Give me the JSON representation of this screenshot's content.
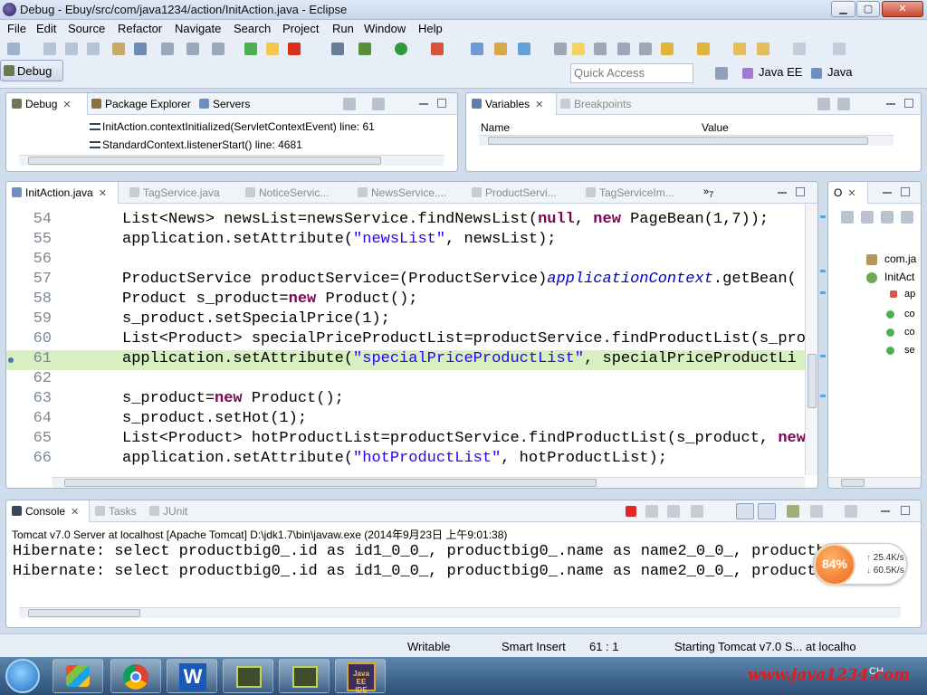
{
  "window": {
    "title": "Debug - Ebuy/src/com/java1234/action/InitAction.java - Eclipse"
  },
  "menu": [
    "File",
    "Edit",
    "Source",
    "Refactor",
    "Navigate",
    "Search",
    "Project",
    "Run",
    "Window",
    "Help"
  ],
  "quick_access": {
    "placeholder": "Quick Access"
  },
  "perspectives": [
    "Java EE",
    "Java",
    "Debug"
  ],
  "debug_view": {
    "tabs": [
      "Debug",
      "Package Explorer",
      "Servers"
    ],
    "frames": [
      "InitAction.contextInitialized(ServletContextEvent) line: 61",
      "StandardContext.listenerStart() line: 4681"
    ]
  },
  "variables_view": {
    "tabs": [
      "Variables",
      "Breakpoints"
    ],
    "columns": [
      "Name",
      "Value"
    ]
  },
  "editor": {
    "tabs": [
      "InitAction.java",
      "TagService.java",
      "NoticeServic...",
      "NewsService....",
      "ProductServi...",
      "TagServiceIm..."
    ],
    "overflow_count": "7",
    "current_line": "61",
    "lines": [
      {
        "n": "54",
        "parts": [
          [
            "",
            "List<News> newsList=newsService.findNewsList("
          ],
          [
            "kw",
            "null"
          ],
          [
            "",
            ", "
          ],
          [
            "kw",
            "new"
          ],
          [
            "",
            " PageBean(1,7));"
          ]
        ]
      },
      {
        "n": "55",
        "parts": [
          [
            "",
            "application.setAttribute("
          ],
          [
            "str",
            "\"newsList\""
          ],
          [
            "",
            ", newsList);"
          ]
        ]
      },
      {
        "n": "56",
        "parts": []
      },
      {
        "n": "57",
        "parts": [
          [
            "",
            "ProductService productService=(ProductService)"
          ],
          [
            "it",
            "applicationContext"
          ],
          [
            "",
            ".getBean("
          ]
        ]
      },
      {
        "n": "58",
        "parts": [
          [
            "",
            "Product s_product="
          ],
          [
            "kw",
            "new"
          ],
          [
            "",
            " Product();"
          ]
        ]
      },
      {
        "n": "59",
        "parts": [
          [
            "",
            "s_product.setSpecialPrice(1);"
          ]
        ]
      },
      {
        "n": "60",
        "parts": [
          [
            "",
            "List<Product> specialPriceProductList=productService.findProductList(s_pro"
          ]
        ]
      },
      {
        "n": "61",
        "parts": [
          [
            "",
            "application.setAttribute("
          ],
          [
            "str",
            "\"specialPriceProductList\""
          ],
          [
            "",
            ", specialPriceProductLi"
          ]
        ]
      },
      {
        "n": "62",
        "parts": []
      },
      {
        "n": "63",
        "parts": [
          [
            "",
            "s_product="
          ],
          [
            "kw",
            "new"
          ],
          [
            "",
            " Product();"
          ]
        ]
      },
      {
        "n": "64",
        "parts": [
          [
            "",
            "s_product.setHot(1);"
          ]
        ]
      },
      {
        "n": "65",
        "parts": [
          [
            "",
            "List<Product> hotProductList=productService.findProductList(s_product, "
          ],
          [
            "kw",
            "new"
          ]
        ]
      },
      {
        "n": "66",
        "parts": [
          [
            "",
            "application.setAttribute("
          ],
          [
            "str",
            "\"hotProductList\""
          ],
          [
            "",
            ", hotProductList);"
          ]
        ]
      }
    ]
  },
  "outline_view": {
    "tab": "O",
    "items": [
      "com.ja",
      "InitAct",
      "ap",
      "co",
      "co",
      "se"
    ]
  },
  "console_view": {
    "tabs": [
      "Console",
      "Tasks",
      "JUnit"
    ],
    "server_line": "Tomcat v7.0 Server at localhost [Apache Tomcat] D:\\jdk1.7\\bin\\javaw.exe (2014年9月23日 上午9:01:38)",
    "lines": [
      "Hibernate: select productbig0_.id as id1_0_0_, productbig0_.name as name2_0_0_, productbi",
      "Hibernate: select productbig0_.id as id1_0_0_, productbig0_.name as name2_0_0_, productbi"
    ]
  },
  "status_bar": {
    "writable": "Writable",
    "insert_mode": "Smart Insert",
    "position": "61 : 1",
    "progress": "Starting Tomcat v7.0 S... at localho"
  },
  "net_widget": {
    "cpu_percent": "84%",
    "up": "25.4K/s",
    "down": "60.5K/s"
  },
  "taskbar": {
    "watermark": "www.java1234.com",
    "ime": "CH"
  },
  "colors": {
    "highlight_line": "#d7efc1",
    "keyword": "#7f0055",
    "string": "#2a00ff",
    "field": "#0000c0"
  }
}
